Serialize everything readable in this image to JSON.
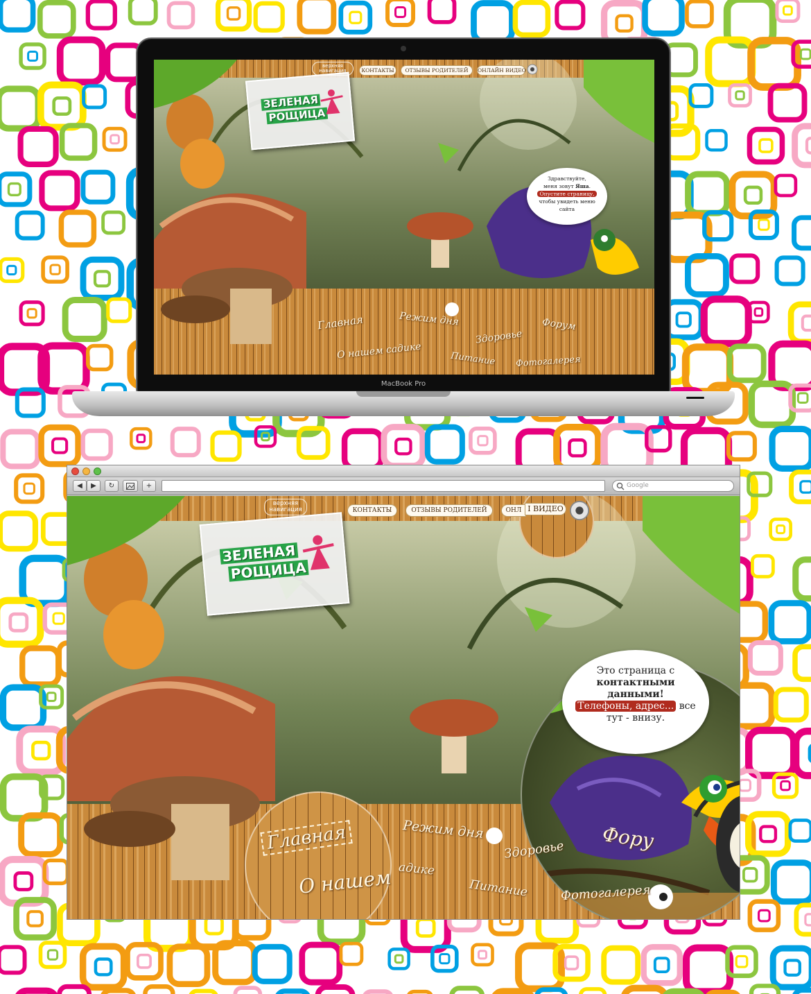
{
  "laptop": {
    "brand": "MacBook Pro",
    "site": {
      "logo_line1": "ЗЕЛЕНАЯ",
      "logo_line2": "РОЩИЦА",
      "top_nav_label": "верхняя навигация",
      "top_nav": [
        "КОНТАКТЫ",
        "ОТЗЫВЫ РОДИТЕЛЕЙ",
        "ОНЛАЙН ВИДЕО"
      ],
      "bubble": {
        "line1": "Здравствуйте,",
        "line2_a": "меня зовут ",
        "line2_b": "Яша",
        "line2_c": ".",
        "highlight": "Опустите страницу,",
        "line4": "чтобы увидеть меню",
        "line5": "сайта"
      },
      "fence_nav": [
        "Главная",
        "Режим дня",
        "Здоровье",
        "Форум",
        "О нашем садике",
        "Питание",
        "Фотогалерея"
      ]
    }
  },
  "browser": {
    "search_placeholder": "Google",
    "buttons": {
      "back": "◀",
      "forward": "▶",
      "reload": "↻",
      "add": "+"
    },
    "site": {
      "logo_line1": "ЗЕЛЕНАЯ",
      "logo_line2": "РОЩИЦА",
      "top_nav_label": "верхняя навигация",
      "top_nav": [
        "КОНТАКТЫ",
        "ОТЗЫВЫ РОДИТЕЛЕЙ",
        "ОНЛ",
        "I ВИДЕО"
      ],
      "bubble": {
        "line1": "Это страница с",
        "line2": "контактными",
        "line3": "данными!",
        "highlight": "Телефоны, адрес...",
        "line4_tail": " все",
        "line5": "тут - внизу."
      },
      "fence_nav": [
        "Главная",
        "Режим дня",
        "Здоровье",
        "Фору",
        "О нашем",
        "адике",
        "Питание",
        "Фотогалерея"
      ]
    }
  },
  "colors": {
    "squares": [
      "#e6007e",
      "#00a0e3",
      "#ffe600",
      "#8cc63f",
      "#f39c12",
      "#f7a8c4"
    ],
    "fence": "#c98a3c",
    "leaf": "#5da82a",
    "toucan_beak": "#ffcc00"
  }
}
